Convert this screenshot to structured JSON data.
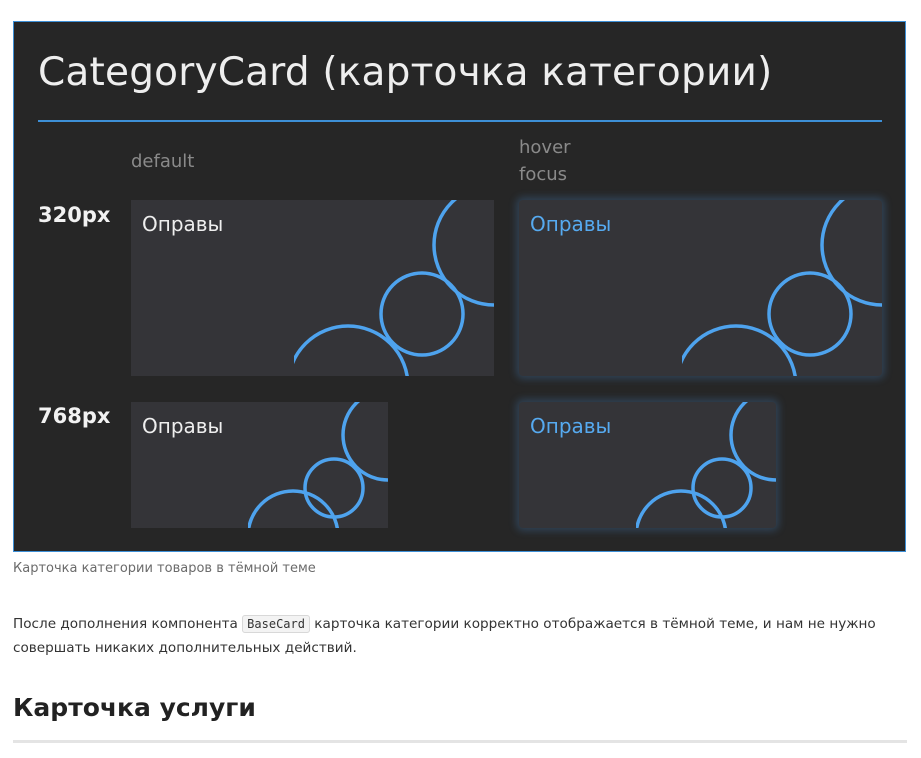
{
  "figure": {
    "title": "CategoryCard (карточка категории)",
    "states": {
      "default": "default",
      "hover_line1": "hover",
      "hover_line2": "focus"
    },
    "rows": [
      {
        "label": "320px",
        "card_label": "Оправы"
      },
      {
        "label": "768px",
        "card_label": "Оправы"
      }
    ],
    "colors": {
      "background": "#262626",
      "accent": "#4ea3ee",
      "card": "#343438"
    },
    "decoration_icon": "circles-decoration-icon"
  },
  "caption": "Карточка категории товаров в тёмной теме",
  "paragraph": {
    "before": "После дополнения компонента",
    "code": "BaseCard",
    "after": "карточка категории корректно отображается в тёмной теме, и нам не нужно совершать никаких дополнительных действий."
  },
  "heading": "Карточка услуги"
}
